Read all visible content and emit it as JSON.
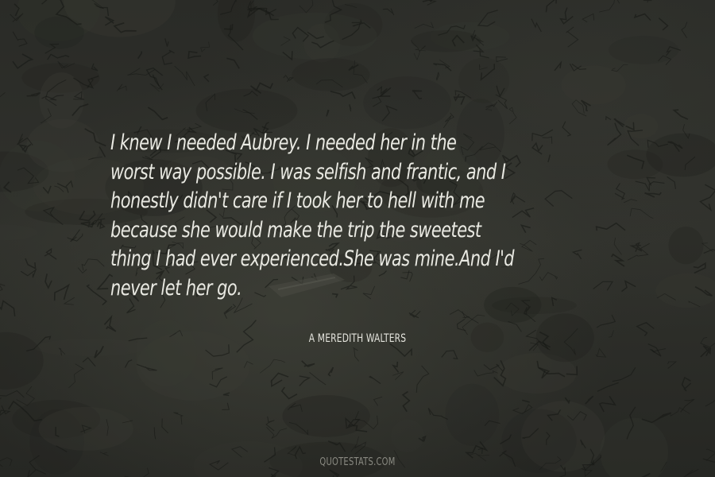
{
  "background": {
    "description_icon": "cracked-earth-texture",
    "base_color": "#2d2e29"
  },
  "quote": {
    "lines": [
      "I knew I needed Aubrey. I needed her in the",
      "worst way possible. I was selfish and frantic, and I",
      "honestly didn't care if I took her to hell with me",
      "because she would make the trip the sweetest",
      "thing I had ever experienced.She was mine.And I'd",
      "never let her go."
    ],
    "text_color": "#e9e9e2"
  },
  "author": "A MEREDITH WALTERS",
  "brand": "QUOTESTATS.COM"
}
